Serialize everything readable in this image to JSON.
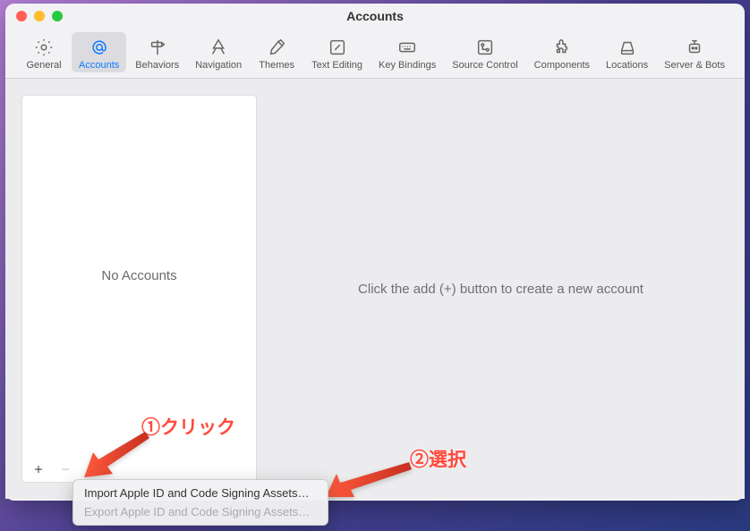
{
  "window": {
    "title": "Accounts"
  },
  "toolbar": {
    "items": [
      {
        "label": "General"
      },
      {
        "label": "Accounts"
      },
      {
        "label": "Behaviors"
      },
      {
        "label": "Navigation"
      },
      {
        "label": "Themes"
      },
      {
        "label": "Text Editing"
      },
      {
        "label": "Key Bindings"
      },
      {
        "label": "Source Control"
      },
      {
        "label": "Components"
      },
      {
        "label": "Locations"
      },
      {
        "label": "Server & Bots"
      }
    ]
  },
  "sidebar": {
    "empty_label": "No Accounts"
  },
  "main": {
    "empty_msg": "Click the add (+) button to create a new account"
  },
  "menu": {
    "import_label": "Import Apple ID and Code Signing Assets…",
    "export_label": "Export Apple ID and Code Signing Assets…"
  },
  "annotations": {
    "step1": "①クリック",
    "step2": "②選択"
  }
}
